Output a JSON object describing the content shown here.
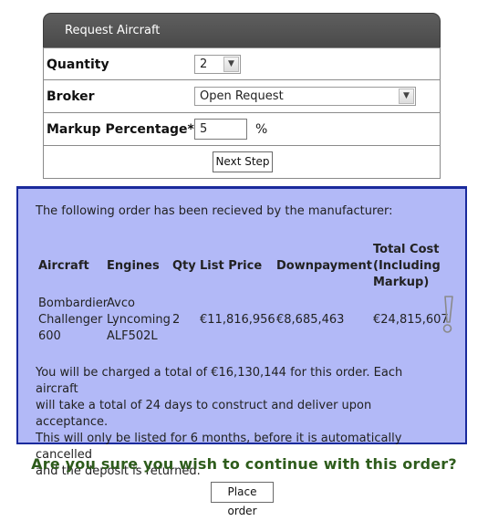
{
  "request_panel": {
    "title": "Request Aircraft",
    "quantity": {
      "label": "Quantity",
      "value": "2",
      "arrow": "chevron-down-icon"
    },
    "broker": {
      "label": "Broker",
      "value": "Open Request",
      "arrow": "chevron-down-icon"
    },
    "markup": {
      "label": "Markup Percentage*",
      "value": "5",
      "unit": "%"
    },
    "next_button": "Next Step"
  },
  "order": {
    "intro": "The following order has been recieved by the manufacturer:",
    "headers": {
      "aircraft": "Aircraft",
      "engines": "Engines",
      "qty": "Qty",
      "list_price": "List Price",
      "downpayment": "Downpayment",
      "total_cost_1": "Total Cost",
      "total_cost_2": "(Including",
      "total_cost_3": "Markup)"
    },
    "row": {
      "aircraft_1": "Bombardier",
      "aircraft_2": "Challenger",
      "aircraft_3": "600",
      "engines_1": "Avco",
      "engines_2": "Lyncoming",
      "engines_3": "ALF502L",
      "qty": "2",
      "list_price": "€11,816,956",
      "downpayment": "€8,685,463",
      "total_cost": "€24,815,607"
    },
    "warning_icon": "exclamation-icon",
    "footer_1": "You will be charged a total of €16,130,144 for this order. Each aircraft",
    "footer_2": "will take a total of 24 days to construct and deliver upon acceptance.",
    "footer_3": "This will only be listed for 6 months, before it is automatically cancelled",
    "footer_4": "and the deposit is returned."
  },
  "confirm": {
    "question": "Are you sure you wish to continue with this order?",
    "place_button": "Place order"
  },
  "colors": {
    "header_bg": "#505050",
    "order_bg": "#b2b9f7",
    "order_border": "#1a2a9c",
    "confirm_text": "#2e5c1c"
  }
}
